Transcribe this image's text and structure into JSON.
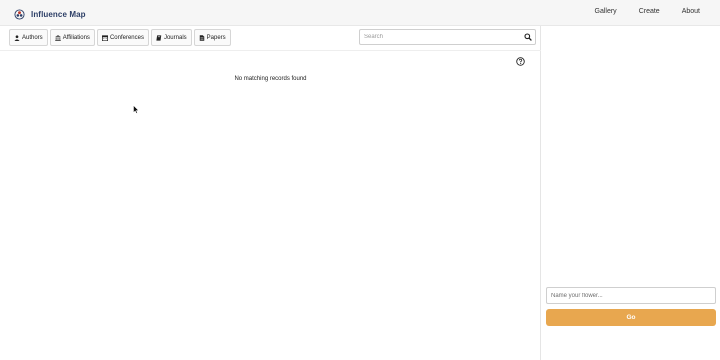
{
  "brand": {
    "title": "Influence Map",
    "logo_icon": "flower-logo-icon"
  },
  "nav": {
    "items": [
      {
        "label": "Gallery"
      },
      {
        "label": "Create"
      },
      {
        "label": "About"
      }
    ]
  },
  "filters": [
    {
      "label": "Authors",
      "icon": "user-icon"
    },
    {
      "label": "Affiliations",
      "icon": "institution-icon"
    },
    {
      "label": "Conferences",
      "icon": "calendar-icon"
    },
    {
      "label": "Journals",
      "icon": "book-icon"
    },
    {
      "label": "Papers",
      "icon": "document-icon"
    }
  ],
  "search": {
    "placeholder": "Search",
    "value": ""
  },
  "results": {
    "empty_message": "No matching records found"
  },
  "flower": {
    "name_placeholder": "Name your flower...",
    "go_label": "Go"
  },
  "colors": {
    "brand": "#2c3e66",
    "go_button": "#e8a74f",
    "navbar_bg": "#f6f6f6"
  }
}
